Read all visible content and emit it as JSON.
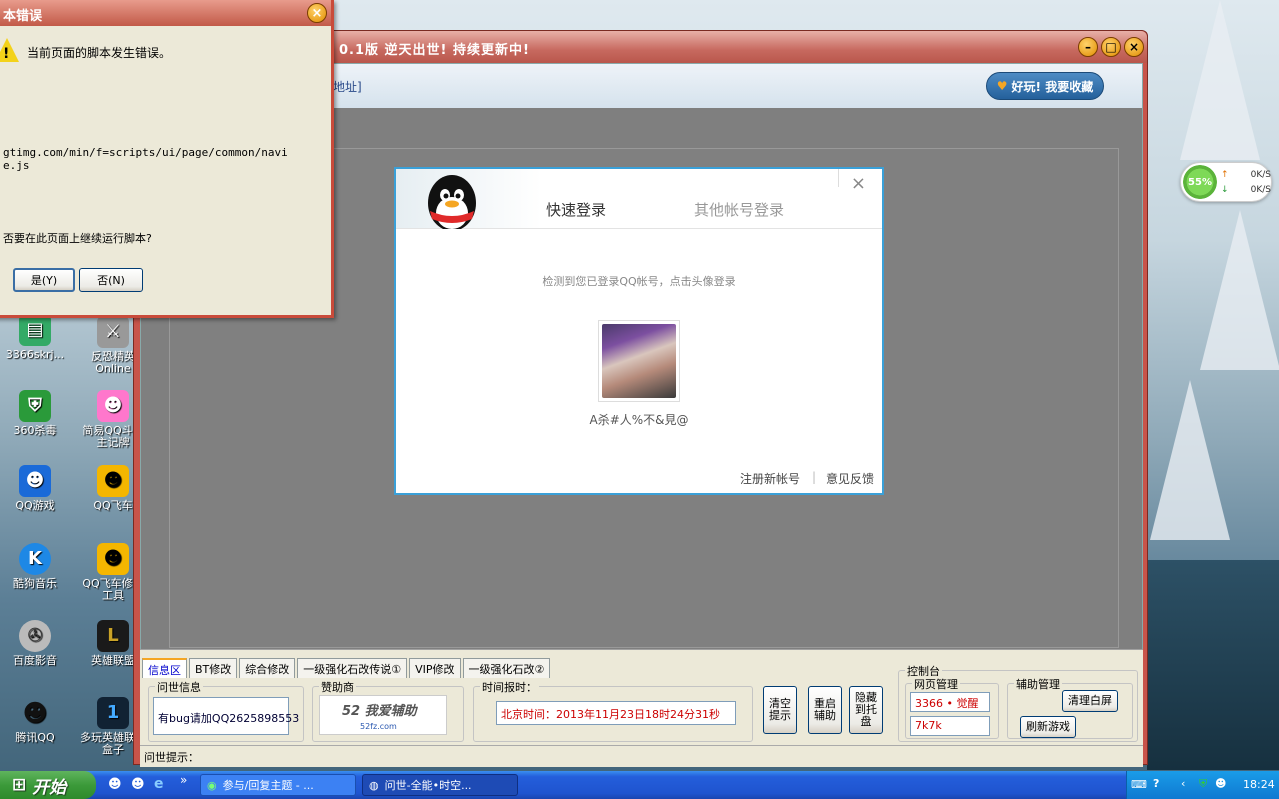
{
  "desktop": {
    "icons": [
      {
        "label": "3366skrj..."
      },
      {
        "label": "反恐精英Online"
      },
      {
        "label": "360杀毒"
      },
      {
        "label": "简易QQ斗地主记牌"
      },
      {
        "label": "QQ游戏"
      },
      {
        "label": "QQ飞车"
      },
      {
        "label": "酷狗音乐"
      },
      {
        "label": "QQ飞车修复工具"
      },
      {
        "label": "百度影音"
      },
      {
        "label": "英雄联盟"
      },
      {
        "label": "腾讯QQ"
      },
      {
        "label": "多玩英雄联盟盒子"
      }
    ]
  },
  "error_dialog": {
    "title": "本错误",
    "message": "当前页面的脚本发生错误。",
    "url_line1": "gtimg.com/min/f=scripts/ui/page/common/navi",
    "url_line2": "e.js",
    "question": "否要在此页面上继续运行脚本?",
    "yes_label": "是(Y)",
    "no_label": "否(N)",
    "close_glyph": "×"
  },
  "app_window": {
    "title": "0.1版  逆天出世! 持续更新中!",
    "address_text": "戏地址]",
    "favorite_label": "好玩! 我要收藏",
    "tabs": [
      {
        "label": "信息区",
        "active": true
      },
      {
        "label": "BT修改",
        "active": false
      },
      {
        "label": "综合修改",
        "active": false
      },
      {
        "label": "一级强化石改传说①",
        "active": false
      },
      {
        "label": "VIP修改",
        "active": false
      },
      {
        "label": "一级强化石改②",
        "active": false
      }
    ],
    "info_group_label": "问世信息",
    "info_text": "有bug请加QQ2625898553",
    "sponsor_label": "赞助商",
    "sponsor_banner": "52 我爱辅助",
    "sponsor_sub": "52fz.com",
    "time_label": "时间报时：",
    "time_value": "北京时间：2013年11月23日18时24分31秒",
    "btn_clear": "清空提示",
    "btn_restart": "重启辅助",
    "btn_hide": "隐藏到托盘",
    "control_label": "控制台",
    "web_label": "网页管理",
    "web_item1": "3366 • 觉醒",
    "web_item2": "7k7k",
    "assist_label": "辅助管理",
    "btn_clear_screen": "清理白屏",
    "btn_refresh_game": "刷新游戏",
    "status_text": "问世提示："
  },
  "login_dialog": {
    "tab_quick": "快速登录",
    "tab_other": "其他帐号登录",
    "close_glyph": "×",
    "detect_text": "检测到您已登录QQ帐号，点击头像登录",
    "username": "A杀#人%不&見@",
    "register_link": "注册新帐号",
    "feedback_link": "意见反馈",
    "separator": "|"
  },
  "net_widget": {
    "percent": "55%",
    "up": "0K/S",
    "down": "0K/S"
  },
  "taskbar": {
    "start_label": "开始",
    "task1": "参与/回复主题 - ...",
    "task2": "问世-全能•时空...",
    "clock": "18:24",
    "chevrons": "»"
  },
  "colors": {
    "taskbar_blue": "#245edb",
    "start_green": "#3c9a3a",
    "app_frame_red": "#c8544a",
    "login_border": "#3aa0d8"
  }
}
